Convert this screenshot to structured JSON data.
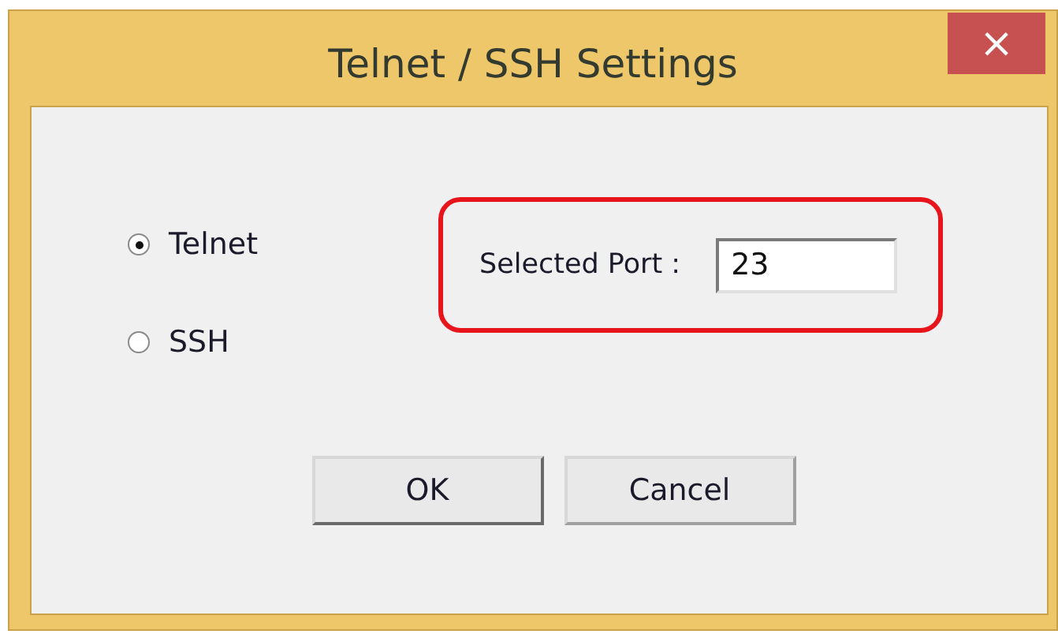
{
  "window": {
    "title": "Telnet / SSH Settings",
    "close": "×"
  },
  "protocols": [
    {
      "label": "Telnet",
      "selected": true
    },
    {
      "label": "SSH",
      "selected": false
    }
  ],
  "port": {
    "label": "Selected Port :",
    "value": "23",
    "highlighted": true
  },
  "buttons": [
    {
      "label": "OK",
      "default": true
    },
    {
      "label": "Cancel",
      "default": false
    }
  ]
}
